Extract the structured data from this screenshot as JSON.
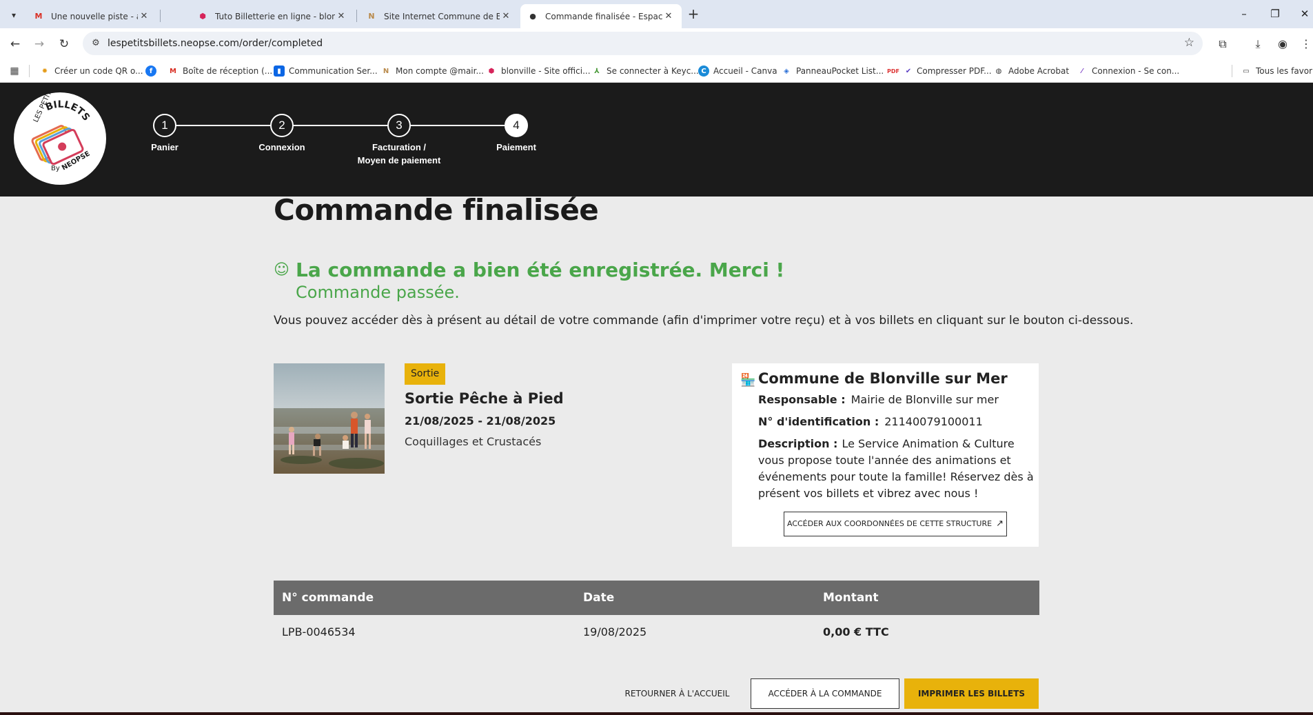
{
  "browser": {
    "tabs": [
      {
        "title": "Une nouvelle piste - animation",
        "favicon": "gmail-icon",
        "active": false
      },
      {
        "title": "Tuto Billetterie en ligne - blonv",
        "favicon": "app-icon",
        "active": false
      },
      {
        "title": "Site Internet Commune de Blon",
        "favicon": "notion-icon",
        "active": false
      },
      {
        "title": "Commande finalisée - Espace c",
        "favicon": "dot-icon",
        "active": true
      }
    ],
    "url": "lespetitsbillets.neopse.com/order/completed",
    "bookmarks": [
      {
        "label": "Créer un code QR o...",
        "icon": "gear-icon"
      },
      {
        "label": "",
        "icon": "facebook-icon"
      },
      {
        "label": "Boîte de réception (...",
        "icon": "gmail-icon"
      },
      {
        "label": "Communication Ser...",
        "icon": "trello-icon"
      },
      {
        "label": "Mon compte @mair...",
        "icon": "notion-icon"
      },
      {
        "label": "blonville - Site offici...",
        "icon": "app-icon"
      },
      {
        "label": "Se connecter à Keyc...",
        "icon": "keycloak-icon"
      },
      {
        "label": "Accueil - Canva",
        "icon": "canva-icon"
      },
      {
        "label": "PanneauPocket List...",
        "icon": "panneau-icon"
      },
      {
        "label": "Compresser PDF...",
        "icon": "check-icon"
      },
      {
        "label": "Adobe Acrobat",
        "icon": "globe-icon"
      },
      {
        "label": "Connexion - Se con...",
        "icon": "slash-icon"
      }
    ],
    "all_bookmarks": "Tous les favoris"
  },
  "site": {
    "logo": {
      "top": "BILLETS",
      "left": "LES PETITS",
      "by": "By",
      "brand": "NEOPSE"
    },
    "steps": [
      {
        "num": "1",
        "label": "Panier"
      },
      {
        "num": "2",
        "label": "Connexion"
      },
      {
        "num": "3",
        "label": "Facturation /\nMoyen de paiement"
      },
      {
        "num": "4",
        "label": "Paiement"
      }
    ],
    "current_step": "4"
  },
  "main": {
    "title": "Commande finalisée",
    "success_title": "La commande a bien été enregistrée. Merci !",
    "success_sub": "Commande passée.",
    "info": "Vous pouvez accéder dès à présent au détail de votre commande (afin d'imprimer votre reçu) et à vos billets en cliquant sur le bouton ci-dessous."
  },
  "event": {
    "badge": "Sortie",
    "title": "Sortie Pêche à Pied",
    "dates": "21/08/2025 - 21/08/2025",
    "subtitle": "Coquillages et Crustacés"
  },
  "organizer": {
    "name": "Commune de Blonville sur Mer",
    "responsable_label": "Responsable :",
    "responsable": "Mairie de Blonville sur mer",
    "id_label": "N° d'identification :",
    "id": "21140079100011",
    "desc_label": "Description :",
    "desc": "Le Service Animation & Culture vous propose toute l'année des animations et événements pour toute la famille! Réservez dès à présent vos billets et vibrez avec nous !",
    "link": "ACCÉDER AUX COORDONNÉES DE CETTE STRUCTURE"
  },
  "order": {
    "headers": {
      "number": "N° commande",
      "date": "Date",
      "amount": "Montant"
    },
    "row": {
      "number": "LPB-0046534",
      "date": "19/08/2025",
      "amount": "0,00 € TTC"
    }
  },
  "actions": {
    "home": "RETOURNER À L'ACCUEIL",
    "order": "ACCÉDER À LA COMMANDE",
    "print": "IMPRIMER LES BILLETS"
  },
  "colors": {
    "accent_yellow": "#e8b20b",
    "success_green": "#4aa64a",
    "header_dark": "#1b1b1b",
    "table_head": "#6b6b6b"
  }
}
